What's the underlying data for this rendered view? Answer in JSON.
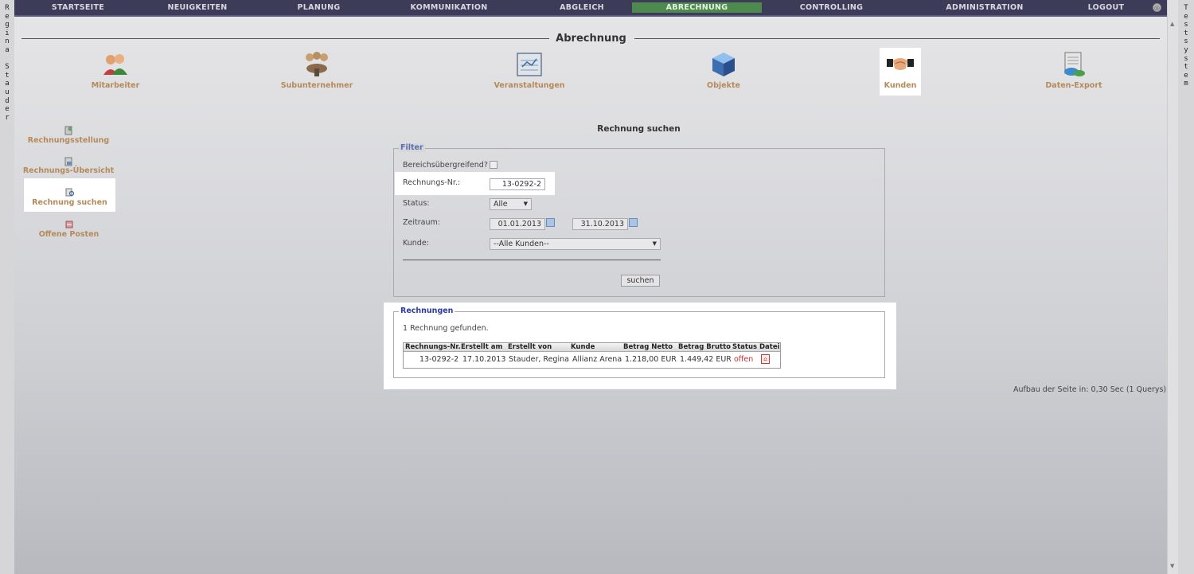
{
  "side_left": [
    "R",
    "e",
    "g",
    "i",
    "n",
    "a",
    " ",
    "S",
    "t",
    "a",
    "u",
    "d",
    "e",
    "r"
  ],
  "side_right": [
    "T",
    "e",
    "s",
    "t",
    "s",
    "y",
    "s",
    "t",
    "e",
    "m"
  ],
  "nav": [
    {
      "label": "STARTSEITE"
    },
    {
      "label": "NEUIGKEITEN"
    },
    {
      "label": "PLANUNG"
    },
    {
      "label": "KOMMUNIKATION"
    },
    {
      "label": "ABGLEICH"
    },
    {
      "label": "ABRECHNUNG",
      "active": true
    },
    {
      "label": "CONTROLLING"
    },
    {
      "label": "ADMINISTRATION"
    },
    {
      "label": "LOGOUT"
    }
  ],
  "page_title": "Abrechnung",
  "modules": [
    {
      "label": "Mitarbeiter",
      "icon": "people-icon"
    },
    {
      "label": "Subunternehmer",
      "icon": "group-icon"
    },
    {
      "label": "Veranstaltungen",
      "icon": "calendar-board-icon"
    },
    {
      "label": "Objekte",
      "icon": "cube-icon"
    },
    {
      "label": "Kunden",
      "icon": "handshake-icon",
      "active": true
    },
    {
      "label": "Daten-Export",
      "icon": "data-export-icon"
    }
  ],
  "subnav": [
    {
      "label": "Rechnungsstellung"
    },
    {
      "label": "Rechnungs-Übersicht"
    },
    {
      "label": "Rechnung suchen",
      "active": true
    },
    {
      "label": "Offene Posten"
    }
  ],
  "section_title": "Rechnung suchen",
  "filter": {
    "legend": "Filter",
    "bereich_label": "Bereichsübergreifend?",
    "nr_label": "Rechnungs-Nr.:",
    "nr_value": "13-0292-2",
    "status_label": "Status:",
    "status_value": "Alle",
    "zeitraum_label": "Zeitraum:",
    "date_from": "01.01.2013",
    "date_to": "31.10.2013",
    "kunde_label": "Kunde:",
    "kunde_value": "--Alle Kunden--",
    "search_button": "suchen"
  },
  "results": {
    "legend": "Rechnungen",
    "count_text": "1 Rechnung gefunden.",
    "columns": [
      "Rechnungs-Nr.",
      "Erstellt am",
      "Erstellt von",
      "Kunde",
      "Betrag Netto",
      "Betrag Brutto",
      "Status",
      "Datei"
    ],
    "rows": [
      {
        "nr": "13-0292-2",
        "date": "17.10.2013",
        "by": "Stauder, Regina",
        "kunde": "Allianz Arena",
        "netto": "1.218,00 EUR",
        "brutto": "1.449,42 EUR",
        "status": "offen"
      }
    ]
  },
  "footer": "Aufbau der Seite in: 0,30 Sec (1 Querys)",
  "colors": {
    "nav_bg": "#3c3c58",
    "active_nav": "#4e8a4e",
    "module_label": "#b58a5a",
    "status_open": "#d03030"
  }
}
